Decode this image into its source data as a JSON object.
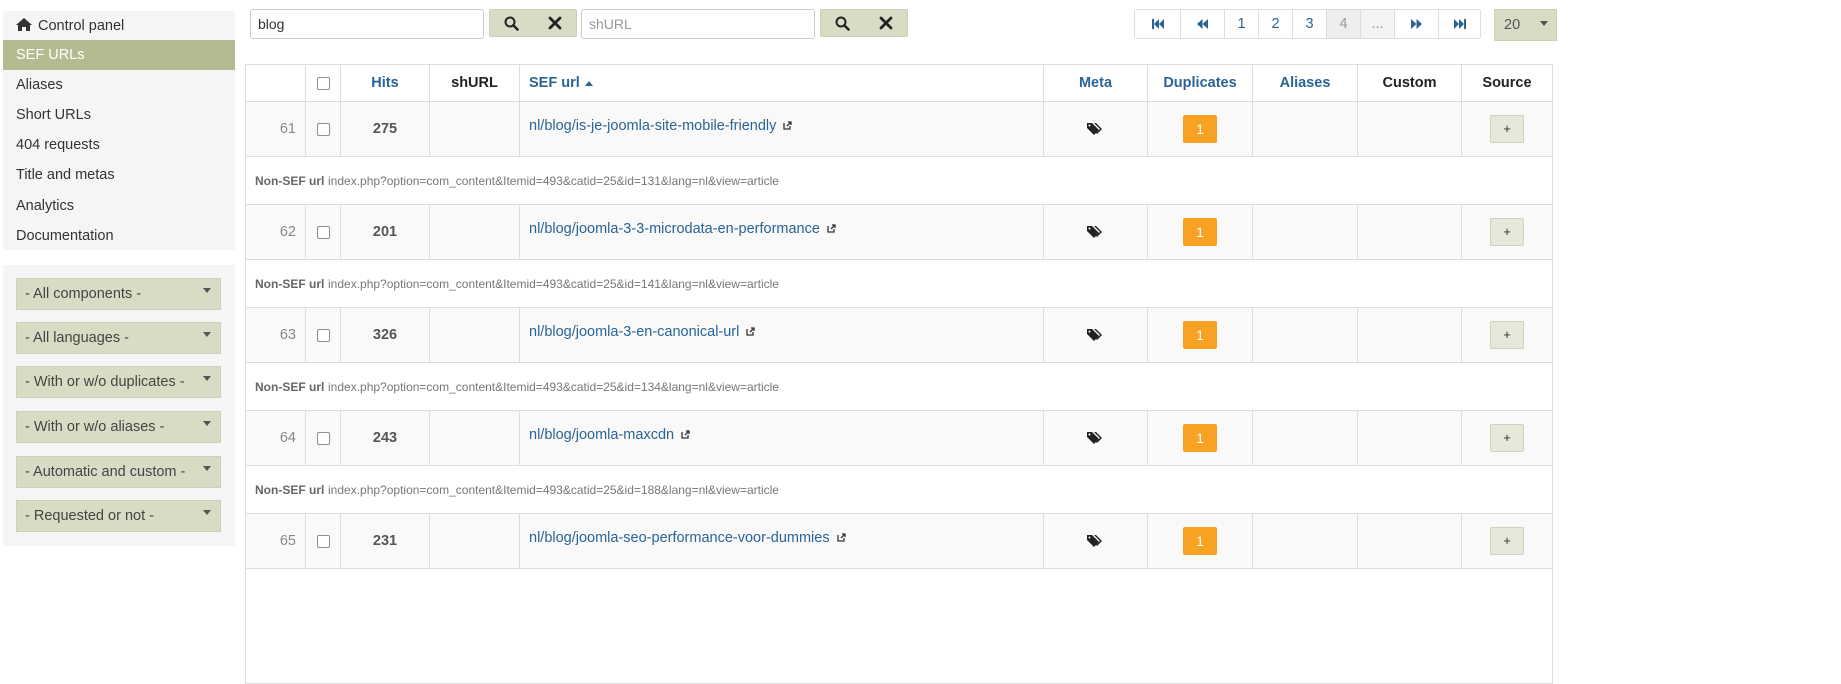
{
  "sidebar": {
    "nav": [
      {
        "label": "Control panel",
        "icon": "home-icon",
        "active": false
      },
      {
        "label": "SEF URLs",
        "active": true
      },
      {
        "label": "Aliases",
        "active": false
      },
      {
        "label": "Short URLs",
        "active": false
      },
      {
        "label": "404 requests",
        "active": false
      },
      {
        "label": "Title and metas",
        "active": false
      },
      {
        "label": "Analytics",
        "active": false
      },
      {
        "label": "Documentation",
        "active": false
      }
    ],
    "filters": [
      "- All components -",
      "- All languages -",
      "- With or w/o duplicates -",
      "- With or w/o aliases -",
      "- Automatic and custom -",
      "- Requested or not -"
    ]
  },
  "search": {
    "sef_value": "blog",
    "sef_placeholder": "",
    "shurl_value": "",
    "shurl_placeholder": "shURL"
  },
  "pagination": {
    "first_icon": "first-page-icon",
    "prev_icon": "previous-page-icon",
    "pages": [
      "1",
      "2",
      "3",
      "4"
    ],
    "current_page": "4",
    "ellipsis": "...",
    "next_icon": "next-page-icon",
    "last_icon": "last-page-icon",
    "limit": "20"
  },
  "table": {
    "headers": {
      "hits": "Hits",
      "shurl": "shURL",
      "sef_url": "SEF url",
      "meta": "Meta",
      "duplicates": "Duplicates",
      "aliases": "Aliases",
      "custom": "Custom",
      "source": "Source"
    },
    "nonsef_label": "Non-SEF url",
    "rows": [
      {
        "num": "61",
        "hits": "275",
        "shurl": "",
        "sef": "nl/blog/is-je-joomla-site-mobile-friendly",
        "duplicates": "1",
        "source": "+",
        "nonsef": "index.php?option=com_content&Itemid=493&catid=25&id=131&lang=nl&view=article"
      },
      {
        "num": "62",
        "hits": "201",
        "shurl": "",
        "sef": "nl/blog/joomla-3-3-microdata-en-performance",
        "duplicates": "1",
        "source": "+",
        "nonsef": "index.php?option=com_content&Itemid=493&catid=25&id=141&lang=nl&view=article"
      },
      {
        "num": "63",
        "hits": "326",
        "shurl": "",
        "sef": "nl/blog/joomla-3-en-canonical-url",
        "duplicates": "1",
        "source": "+",
        "nonsef": "index.php?option=com_content&Itemid=493&catid=25&id=134&lang=nl&view=article"
      },
      {
        "num": "64",
        "hits": "243",
        "shurl": "",
        "sef": "nl/blog/joomla-maxcdn",
        "duplicates": "1",
        "source": "+",
        "nonsef": "index.php?option=com_content&Itemid=493&catid=25&id=188&lang=nl&view=article"
      },
      {
        "num": "65",
        "hits": "231",
        "shurl": "",
        "sef": "nl/blog/joomla-seo-performance-voor-dummies",
        "duplicates": "1",
        "source": "+",
        "nonsef": ""
      }
    ]
  },
  "colors": {
    "accent_green": "#b5bb91",
    "button_green": "#d8dcc4",
    "link_blue": "#2a6496",
    "badge_orange": "#f7a222"
  }
}
